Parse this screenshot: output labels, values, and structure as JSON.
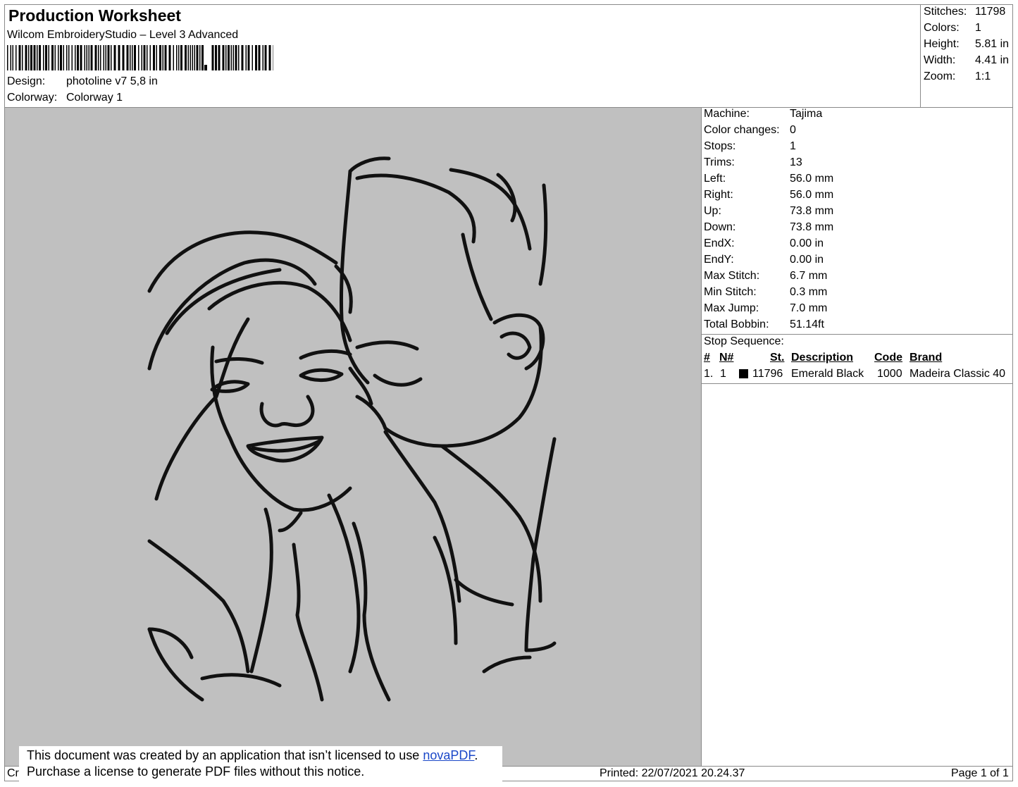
{
  "header": {
    "title": "Production Worksheet",
    "software": "Wilcom EmbroideryStudio – Level 3 Advanced",
    "design_label": "Design:",
    "design_value": "photoline v7 5,8 in",
    "colorway_label": "Colorway:",
    "colorway_value": "Colorway 1"
  },
  "summary": [
    {
      "label": "Stitches:",
      "value": "11798"
    },
    {
      "label": "Colors:",
      "value": "1"
    },
    {
      "label": "Height:",
      "value": "5.81 in"
    },
    {
      "label": "Width:",
      "value": "4.41 in"
    },
    {
      "label": "Zoom:",
      "value": "1:1"
    }
  ],
  "machine_info": [
    {
      "label": "Machine:",
      "value": "Tajima"
    },
    {
      "label": "Color changes:",
      "value": "0"
    },
    {
      "label": "Stops:",
      "value": "1"
    },
    {
      "label": "Trims:",
      "value": "13"
    },
    {
      "label": "Left:",
      "value": "56.0 mm"
    },
    {
      "label": "Right:",
      "value": "56.0 mm"
    },
    {
      "label": "Up:",
      "value": "73.8 mm"
    },
    {
      "label": "Down:",
      "value": "73.8 mm"
    },
    {
      "label": "EndX:",
      "value": "0.00 in"
    },
    {
      "label": "EndY:",
      "value": "0.00 in"
    },
    {
      "label": "Max Stitch:",
      "value": "6.7 mm"
    },
    {
      "label": "Min Stitch:",
      "value": "0.3 mm"
    },
    {
      "label": "Max Jump:",
      "value": "7.0 mm"
    },
    {
      "label": "Total Bobbin:",
      "value": "51.14ft"
    }
  ],
  "stop_sequence": {
    "title": "Stop Sequence:",
    "columns": [
      "#",
      "N#",
      "St.",
      "Description",
      "Code",
      "Brand"
    ],
    "rows": [
      {
        "num": "1.",
        "n": "1",
        "swatch_color": "#000000",
        "stitches": "11796",
        "description": "Emerald Black",
        "code": "1000",
        "brand": "Madeira Classic 40"
      }
    ]
  },
  "notice": {
    "line1_prefix": "This document was created by an application that isn’t licensed to use ",
    "link_text": "novaPDF",
    "line1_suffix": ".",
    "line2": "Purchase a license to generate PDF files without this notice."
  },
  "footer": {
    "left_fragment": "Cr",
    "printed": "Printed: 22/07/2021 20.24.37",
    "page": "Page 1 of 1"
  },
  "colors": {
    "canvas_background": "#c0c0c0",
    "thread": "#111111",
    "link": "#1a47c8"
  }
}
